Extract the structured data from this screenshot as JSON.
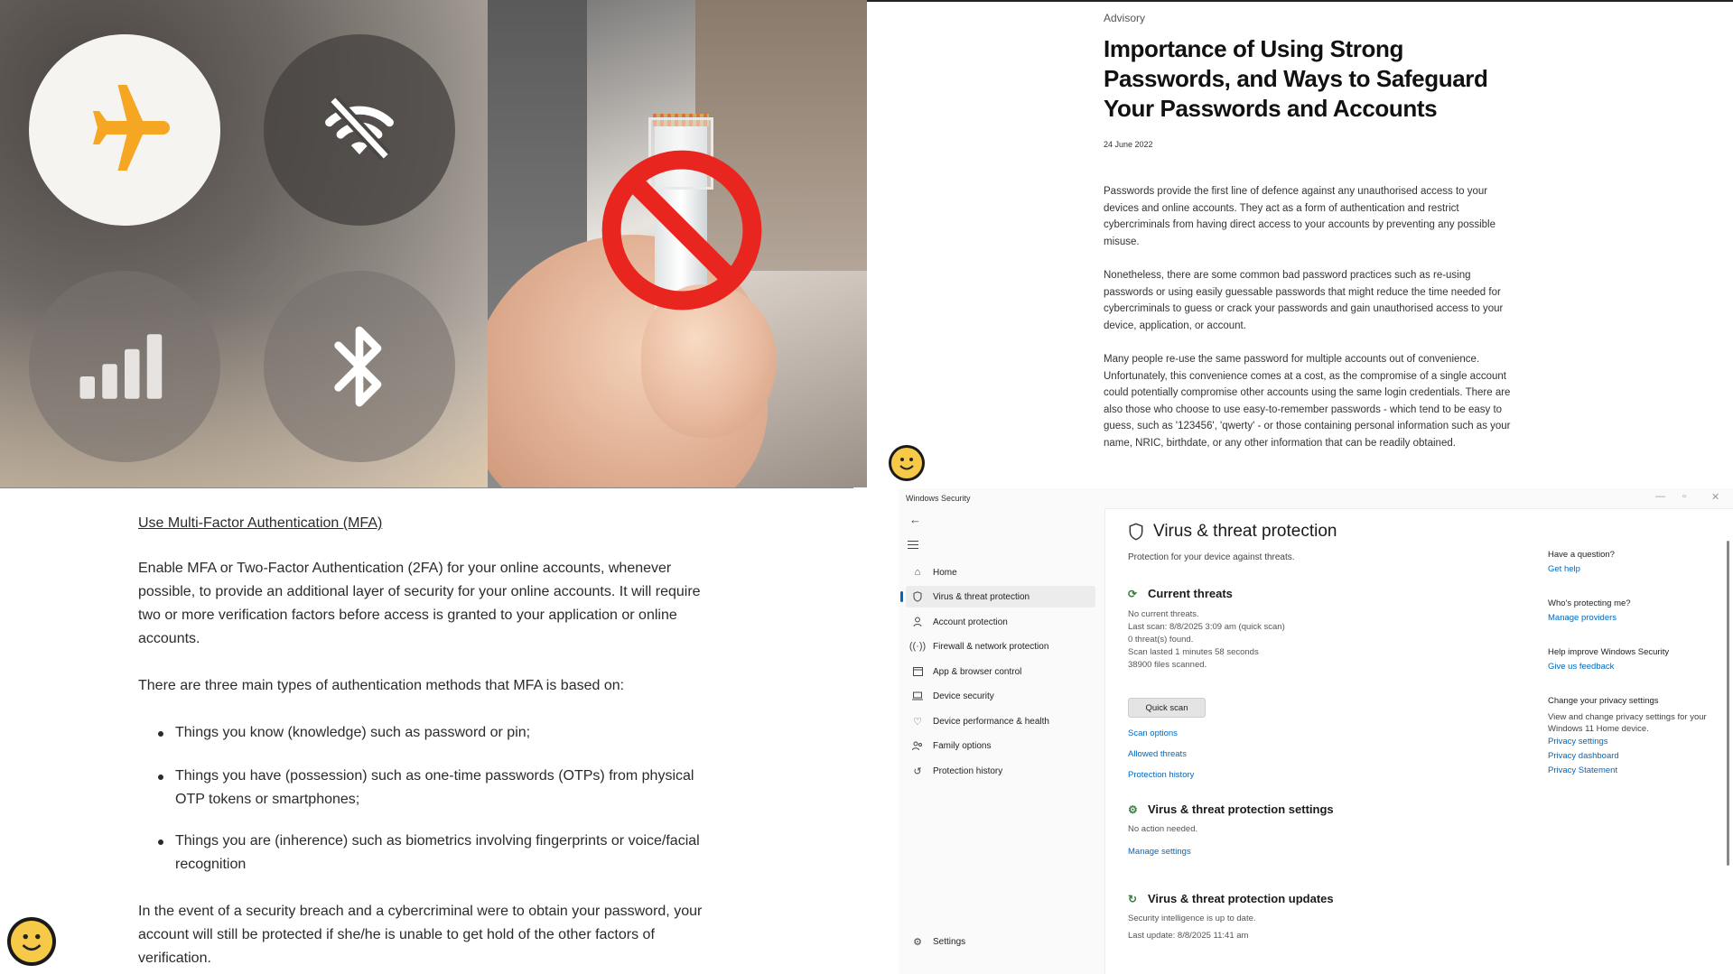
{
  "control_center": {
    "airplane": {
      "state": "on",
      "accent": "#f5a623"
    },
    "wifi": {
      "state": "off"
    },
    "cellular": {
      "state": "off"
    },
    "bluetooth": {
      "state": "off"
    }
  },
  "article": {
    "category": "Advisory",
    "title": "Importance of Using Strong Passwords, and Ways to Safeguard Your Passwords and Accounts",
    "date": "24 June 2022",
    "paragraphs": [
      "Passwords provide the first line of defence against any unauthorised access to your devices and online accounts. They act as a form of authentication and restrict cybercriminals from having direct access to your accounts by preventing any possible misuse.",
      "Nonetheless, there are some common bad password practices such as re-using passwords or using easily guessable passwords that might reduce the time needed for cybercriminals to guess or crack your passwords and gain unauthorised access to your device, application, or account.",
      "Many people re-use the same password for multiple accounts out of convenience. Unfortunately, this convenience comes at a cost, as the compromise of a single account could potentially compromise other accounts using the same login credentials. There are also those who choose to use easy-to-remember passwords - which tend to be easy to guess, such as '123456', 'qwerty' - or those containing personal information such as your name, NRIC, birthdate, or any other information that can be readily obtained."
    ]
  },
  "mfa": {
    "heading": "Use Multi-Factor Authentication (MFA)",
    "intro": "Enable MFA or Two-Factor Authentication (2FA) for your online accounts, whenever possible, to provide an additional layer of security for your online accounts. It will require two or more verification factors before access is granted to your application or online accounts.",
    "types_intro": "There are three main types of authentication methods that MFA is based on:",
    "bullets": [
      "Things you know (knowledge) such as password or pin;",
      "Things you have (possession) such as one-time passwords (OTPs) from physical OTP tokens or smartphones;",
      "Things you are (inherence) such as biometrics involving fingerprints or voice/facial recognition"
    ],
    "conclusion": "In the event of a security breach and a cybercriminal were to obtain your password, your account will still be protected if she/he is unable to get hold of the other factors of verification."
  },
  "windows_security": {
    "window_title": "Windows Security",
    "nav": [
      {
        "label": "Home",
        "icon": "home-icon",
        "active": false
      },
      {
        "label": "Virus & threat protection",
        "icon": "shield-icon",
        "active": true
      },
      {
        "label": "Account protection",
        "icon": "person-icon",
        "active": false
      },
      {
        "label": "Firewall & network protection",
        "icon": "wifi-icon",
        "active": false
      },
      {
        "label": "App & browser control",
        "icon": "browser-icon",
        "active": false
      },
      {
        "label": "Device security",
        "icon": "laptop-icon",
        "active": false
      },
      {
        "label": "Device performance & health",
        "icon": "heart-icon",
        "active": false
      },
      {
        "label": "Family options",
        "icon": "family-icon",
        "active": false
      },
      {
        "label": "Protection history",
        "icon": "history-icon",
        "active": false
      }
    ],
    "settings_label": "Settings",
    "page_title": "Virus & threat protection",
    "page_subtitle": "Protection for your device against threats.",
    "current_threats": {
      "title": "Current threats",
      "lines": [
        "No current threats.",
        "Last scan: 8/8/2025 3:09 am (quick scan)",
        "0 threat(s) found.",
        "Scan lasted 1 minutes 58 seconds",
        "38900 files scanned."
      ],
      "quick_scan_label": "Quick scan",
      "links": [
        "Scan options",
        "Allowed threats",
        "Protection history"
      ]
    },
    "vtp_settings": {
      "title": "Virus & threat protection settings",
      "status": "No action needed.",
      "link": "Manage settings"
    },
    "vtp_updates": {
      "title": "Virus & threat protection updates",
      "status": "Security intelligence is up to date.",
      "last_update": "Last update: 8/8/2025 11:41 am"
    },
    "sidebar": {
      "question_title": "Have a question?",
      "get_help": "Get help",
      "who_title": "Who's protecting me?",
      "manage_providers": "Manage providers",
      "improve_title": "Help improve Windows Security",
      "feedback": "Give us feedback",
      "privacy_title": "Change your privacy settings",
      "privacy_text": "View and change privacy settings for your Windows 11 Home device.",
      "privacy_links": [
        "Privacy settings",
        "Privacy dashboard",
        "Privacy Statement"
      ]
    },
    "accent": "#0067c0"
  }
}
